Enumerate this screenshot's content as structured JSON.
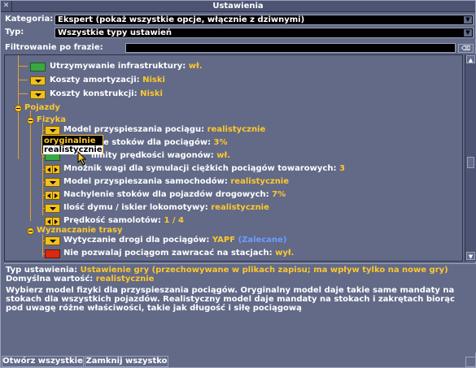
{
  "window": {
    "title": "Ustawienia",
    "close_glyph": "✕"
  },
  "category": {
    "label": "Kategoria:",
    "value": "Ekspert (pokaż wszystkie opcje, włącznie z dziwnymi)"
  },
  "type": {
    "label": "Typ:",
    "value": "Wszystkie typy ustawień"
  },
  "filter": {
    "label": "Filtrowanie po frazie:",
    "value": "",
    "clear_glyph": "⌫"
  },
  "tree": {
    "items": [
      {
        "label": "Utrzymywanie infrastruktury",
        "value": "wł.",
        "control": "toggle-on"
      },
      {
        "label": "Koszty amortyzacji",
        "value": "Niski",
        "control": "dropdown"
      },
      {
        "label": "Koszty konstrukcji",
        "value": "Niski",
        "control": "dropdown"
      },
      {
        "group": "Pojazdy"
      },
      {
        "group": "Fizyka"
      },
      {
        "label": "Model przyspieszania pociągu",
        "value": "realistycznie",
        "control": "dropdown"
      },
      {
        "label": "Nachylenie stoków dla pociągów",
        "value": "3%",
        "control": "dropdown",
        "partial_label": "e stoków dla pociągów"
      },
      {
        "label": "Wyłącz limity prędkości wagonów",
        "value": "wł.",
        "control": "toggle-on",
        "partial_label": "limity prędkości wagonów"
      },
      {
        "label": "Mnożnik wagi dla symulacji ciężkich pociągów towarowych",
        "value": "3",
        "control": "stepper"
      },
      {
        "label": "Model przyspieszania samochodów",
        "value": "realistycznie",
        "control": "dropdown"
      },
      {
        "label": "Nachylenie stoków dla pojazdów drogowych",
        "value": "7%",
        "control": "stepper"
      },
      {
        "label": "Ilość dymu / iskier lokomotywy",
        "value": "realistycznie",
        "control": "dropdown"
      },
      {
        "label": "Prędkość samolotów",
        "value": "1 / 4",
        "control": "stepper"
      },
      {
        "group": "Wyznaczanie trasy"
      },
      {
        "label": "Wytyczanie drogi dla pociągów",
        "value": "YAPF",
        "value_extra": "(Zalecane)",
        "control": "dropdown"
      },
      {
        "label": "Nie pozwalaj pociągom zawracać na stacjach",
        "value": "wył.",
        "control": "toggle-off"
      }
    ],
    "popup": {
      "options": [
        "oryginalnie",
        "realistycznie"
      ],
      "selected": "realistycznie"
    }
  },
  "info": {
    "type_label": "Typ ustawienia:",
    "type_value": "Ustawienie gry (przechowywane w plikach zapisu; ma wpływ tylko na nowe gry)",
    "default_label": "Domyślna wartość:",
    "default_value": "realistycznie",
    "description": "Wybierz model fizyki dla przyspieszania pociągów. Oryginalny model daje takie same mandaty na stokach dla wszystkich pojazdów. Realistyczny model daje mandaty na stokach i zakrętach biorąc pod uwagę różne właściwości, takie jak długość i siłę pociągową"
  },
  "buttons": {
    "expand_all": "Otwórz wszystkie",
    "collapse_all": "Zamknij wszystko"
  },
  "colors": {
    "window_bg": "#626a88",
    "label": "#ffffff",
    "value": "#ffc82c",
    "recommended": "#6f9cff",
    "toggle_on": "#3aa840",
    "toggle_off": "#d62a14"
  }
}
